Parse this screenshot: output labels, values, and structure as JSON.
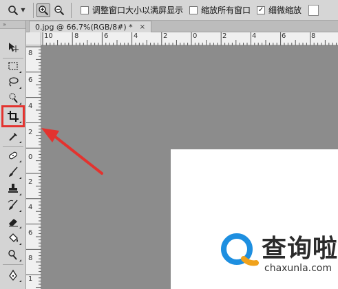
{
  "options_bar": {
    "tool_icon": "zoom-tool-icon",
    "zoom_in_icon": "zoom-in-icon",
    "zoom_out_icon": "zoom-out-icon",
    "options": [
      {
        "label": "调整窗口大小以满屏显示",
        "checked": false
      },
      {
        "label": "缩放所有窗口",
        "checked": false
      },
      {
        "label": "细微缩放",
        "checked": true
      }
    ]
  },
  "document_tab": {
    "title": "0.jpg @ 66.7%(RGB/8#) *",
    "close": "×"
  },
  "rulers": {
    "horizontal": [
      "10",
      "8",
      "6",
      "4",
      "2",
      "0",
      "2",
      "4",
      "6",
      "8"
    ],
    "vertical": [
      "8",
      "6",
      "4",
      "2",
      "0",
      "2",
      "4",
      "6",
      "8",
      "1",
      "1"
    ]
  },
  "toolbox": {
    "grip": "»",
    "tools": [
      {
        "name": "move-tool",
        "icon": "move-icon"
      },
      {
        "name": "marquee-tool",
        "icon": "rect-marquee-icon"
      },
      {
        "name": "lasso-tool",
        "icon": "lasso-icon"
      },
      {
        "name": "quick-select-tool",
        "icon": "magic-wand-icon"
      },
      {
        "name": "crop-tool",
        "icon": "crop-icon",
        "highlighted": true
      },
      {
        "name": "eyedropper-tool",
        "icon": "eyedropper-icon"
      },
      {
        "name": "healing-tool",
        "icon": "bandage-icon"
      },
      {
        "name": "brush-tool",
        "icon": "brush-icon"
      },
      {
        "name": "stamp-tool",
        "icon": "stamp-icon"
      },
      {
        "name": "history-brush-tool",
        "icon": "history-brush-icon"
      },
      {
        "name": "eraser-tool",
        "icon": "eraser-icon"
      },
      {
        "name": "paint-bucket-tool",
        "icon": "paint-bucket-icon"
      },
      {
        "name": "dodge-tool",
        "icon": "dodge-icon"
      },
      {
        "name": "pen-tool",
        "icon": "pen-icon"
      }
    ]
  },
  "annotation": {
    "color": "#e3332f"
  },
  "watermark": {
    "name": "查询啦",
    "url": "chaxunla.com",
    "colors": {
      "ring": "#1e8fe0",
      "tail": "#f0a21c"
    }
  }
}
